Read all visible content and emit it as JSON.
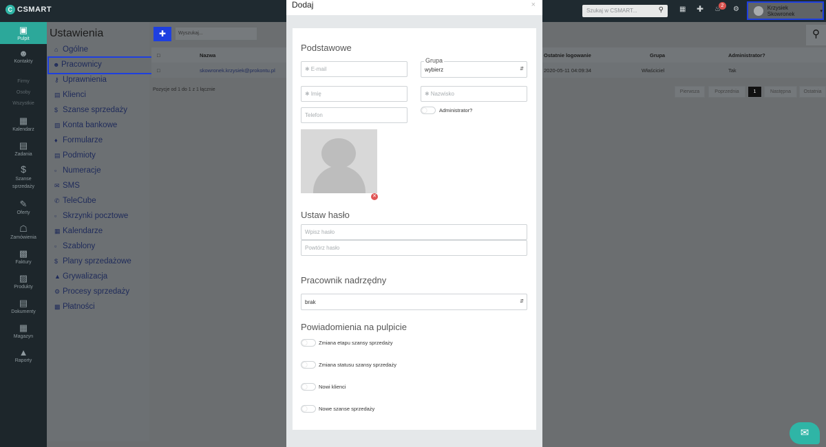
{
  "app": {
    "logo_text": "CSMART"
  },
  "topbar": {
    "search_placeholder": "Szukaj w CSMART...",
    "notification_count": "2",
    "user_name": "Krzysiek Skowronek"
  },
  "leftnav": {
    "items": [
      {
        "label": "Pulpit",
        "icon": "monitor-icon"
      },
      {
        "label": "Kontakty",
        "icon": "people-icon"
      },
      {
        "label": "Kalendarz",
        "icon": "calendar-icon"
      },
      {
        "label": "Zadania",
        "icon": "tasks-icon"
      },
      {
        "label": "Szanse sprzedaży",
        "icon": "dollar-icon"
      },
      {
        "label": "Oferty",
        "icon": "pen-icon"
      },
      {
        "label": "Zamówienia",
        "icon": "cart-icon"
      },
      {
        "label": "Faktury",
        "icon": "invoice-icon"
      },
      {
        "label": "Produkty",
        "icon": "box-icon"
      },
      {
        "label": "Dokumenty",
        "icon": "document-icon"
      },
      {
        "label": "Magazyn",
        "icon": "grid-icon"
      },
      {
        "label": "Raporty",
        "icon": "chart-icon"
      }
    ],
    "sub_items": [
      "Firmy",
      "Osoby",
      "Wszystkie"
    ]
  },
  "settings": {
    "title": "Ustawienia",
    "items": [
      "Ogólne",
      "Pracownicy",
      "Uprawnienia",
      "Klienci",
      "Szanse sprzedaży",
      "Konta bankowe",
      "Formularze",
      "Podmioty",
      "Numeracje",
      "SMS",
      "TeleCube",
      "Skrzynki pocztowe",
      "Kalendarze",
      "Szablony",
      "Plany sprzedażowe",
      "Grywalizacja",
      "Procesy sprzedaży",
      "Płatności"
    ],
    "active": "Pracownicy"
  },
  "list": {
    "search_placeholder": "Wyszukaj...",
    "columns": [
      "Nazwa",
      "Ostatnie logowanie",
      "Grupa",
      "Administrator?"
    ],
    "row": {
      "email": "skowronek.krzysiek@prokontu.pl",
      "last_login": "2020-05-11 04:09:34",
      "group": "Właściciel",
      "admin": "Tak"
    },
    "position_info": "Pozycje od 1 do 1 z 1 łącznie",
    "pager": [
      "Pierwsza",
      "Poprzednia",
      "1",
      "Następna",
      "Ostatnia"
    ]
  },
  "modal": {
    "title": "Dodaj",
    "close": "×",
    "basic": {
      "section": "Podstawowe",
      "email_placeholder": "E-mail",
      "group_label": "Grupa",
      "group_value": "wybierz",
      "first_name_placeholder": "Imię",
      "last_name_placeholder": "Nazwisko",
      "phone_placeholder": "Telefon",
      "admin_label": "Administrator?"
    },
    "password": {
      "section": "Ustaw hasło",
      "password_placeholder": "Wpisz hasło",
      "repeat_placeholder": "Powtórz hasło"
    },
    "supervisor": {
      "section": "Pracownik nadrzędny",
      "value": "brak"
    },
    "notifications": {
      "section": "Powiadomienia na pulpicie",
      "items": [
        "Zmiana etapu szansy sprzedaży",
        "Zmiana statusu szansy sprzedaży",
        "Nowi klienci",
        "Nowe szanse sprzedaży"
      ]
    }
  },
  "colors": {
    "accent": "#2fb5a6",
    "highlight": "#1e3fe0",
    "danger": "#d9534f"
  }
}
